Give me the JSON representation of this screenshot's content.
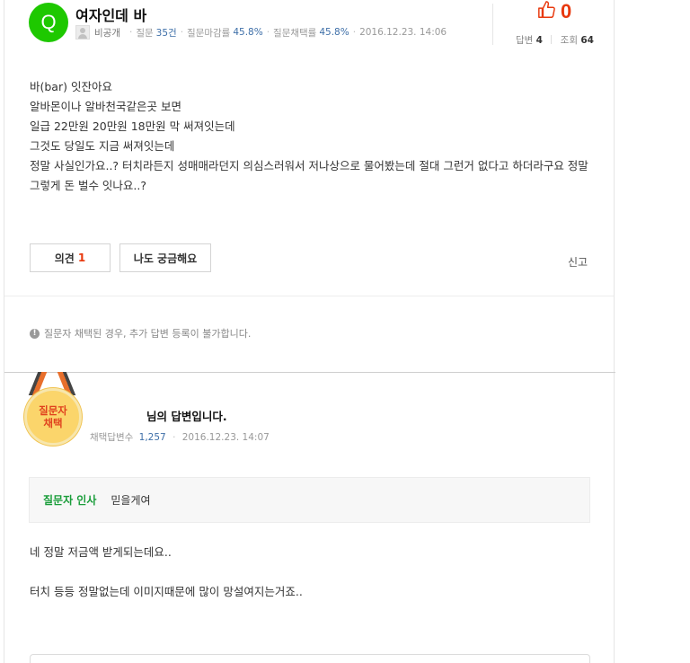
{
  "question": {
    "badge": "Q",
    "title": "여자인데 바",
    "user": "비공개",
    "stats": [
      {
        "label": "질문",
        "value": "35건"
      },
      {
        "label": "질문마감률",
        "value": "45.8%"
      },
      {
        "label": "질문채택률",
        "value": "45.8%"
      }
    ],
    "date": "2016.12.23. 14:06",
    "likes": "0",
    "answers_label": "답변",
    "answers_count": "4",
    "views_label": "조회",
    "views_count": "64",
    "body": [
      "바(bar) 잇잔아요",
      "알바몬이나 알바천국같은곳 보면",
      "일급 22만원 20만원 18만원 막 써져잇는데",
      "그것도 당일도 지금 써져잇는데",
      "정말 사실인가요..? 터치라든지 성매매라던지 의심스러워서 저나상으로 물어봤는데 절대 그런거 없다고 하더라구요 정말 그렇게 돈 벌수 잇나요..?"
    ],
    "opinion_label": "의견",
    "opinion_count": "1",
    "curious_label": "나도 궁금해요",
    "report_label": "신고"
  },
  "notice": {
    "icon": "!",
    "text": "질문자 채택된 경우, 추가 답변 등록이 불가합니다."
  },
  "answer": {
    "medal_line1": "질문자",
    "medal_line2": "채택",
    "title": "님의 답변입니다.",
    "meta_label": "채택답변수",
    "meta_count": "1,257",
    "date": "2016.12.23. 14:07",
    "greet_label": "질문자 인사",
    "greet_text": "믿을게여",
    "body": [
      "네 정말 저금액 받게되는데요..",
      "터치 등등 정말없는데 이미지때문에 많이 망설여지는거죠.."
    ]
  },
  "colors": {
    "brand_green": "#1ec800",
    "like_red": "#e8380d",
    "greet_green": "#1a9d3a",
    "link_blue": "#3e6fa8"
  }
}
